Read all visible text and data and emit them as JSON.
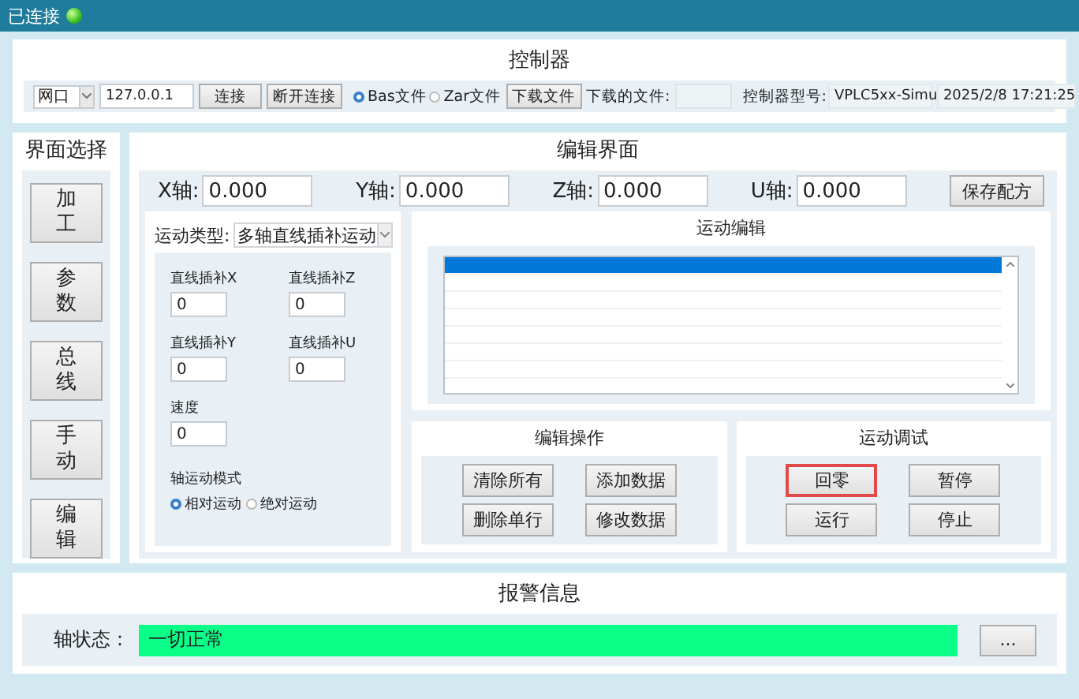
{
  "status_bar": {
    "label": "已连接",
    "connected": true
  },
  "controller": {
    "title": "控制器",
    "port": "网口",
    "ip": "127.0.0.1",
    "buttons": [
      "连接",
      "断开连接"
    ],
    "file_types": [
      {
        "label": "Bas文件",
        "selected": true
      },
      {
        "label": "Zar文件",
        "selected": false
      }
    ],
    "download_button": "下载文件",
    "downloaded_file_label": "下载的文件:",
    "model": {
      "label": "控制器型号:",
      "value": "VPLC5xx-Simu"
    },
    "datetime": "2025/2/8 17:21:25"
  },
  "sidebar": {
    "title": "界面选择",
    "items": [
      {
        "label": "加工"
      },
      {
        "label": "参数"
      },
      {
        "label": "总线"
      },
      {
        "label": "手动"
      },
      {
        "label": "编辑"
      }
    ]
  },
  "editor": {
    "title": "编辑界面",
    "axes": [
      {
        "label": "X轴:",
        "value": "0.000"
      },
      {
        "label": "Y轴:",
        "value": "0.000"
      },
      {
        "label": "Z轴:",
        "value": "0.000"
      },
      {
        "label": "U轴:",
        "value": "0.000"
      }
    ],
    "save_button": "保存配方",
    "motion_type": {
      "label": "运动类型:",
      "value": "多轴直线插补运动"
    },
    "params": [
      {
        "label": "直线插补X",
        "value": "0"
      },
      {
        "label": "直线插补Z",
        "value": "0"
      },
      {
        "label": "直线插补Y",
        "value": "0"
      },
      {
        "label": "直线插补U",
        "value": "0"
      },
      {
        "label": "速度",
        "value": "0"
      }
    ],
    "axis_mode": {
      "label": "轴运动模式",
      "options": [
        {
          "label": "相对运动",
          "selected": true
        },
        {
          "label": "绝对运动",
          "selected": false
        }
      ]
    },
    "motion_edit": {
      "title": "运动编辑",
      "rows": [
        {
          "selected": true
        },
        {
          "selected": false
        },
        {
          "selected": false
        },
        {
          "selected": false
        },
        {
          "selected": false
        },
        {
          "selected": false
        },
        {
          "selected": false
        }
      ]
    },
    "edit_ops": {
      "title": "编辑操作",
      "buttons": [
        "清除所有",
        "添加数据",
        "删除单行",
        "修改数据"
      ]
    },
    "debug": {
      "title": "运动调试",
      "buttons": [
        {
          "label": "回零",
          "focused": true
        },
        {
          "label": "暂停",
          "focused": false
        },
        {
          "label": "运行",
          "focused": false
        },
        {
          "label": "停止",
          "focused": false
        }
      ]
    }
  },
  "alarm": {
    "title": "报警信息",
    "label": "轴状态：",
    "value": "一切正常",
    "ok": true,
    "more_button": "..."
  }
}
